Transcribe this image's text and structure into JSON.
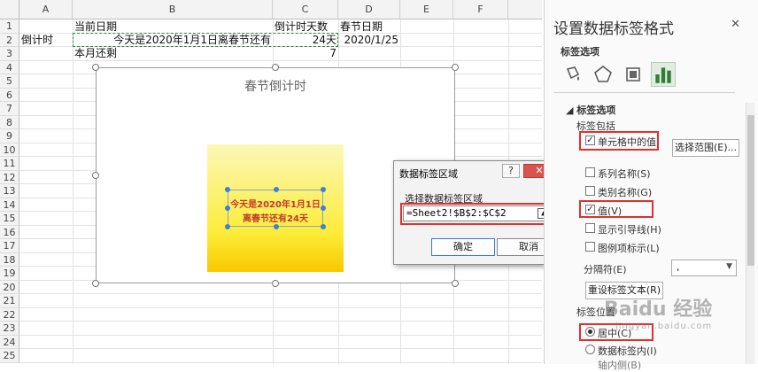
{
  "sheet": {
    "columns": [
      "A",
      "B",
      "C",
      "D",
      "E",
      "F"
    ],
    "rows": [
      "1",
      "2",
      "3",
      "4",
      "5",
      "6",
      "7",
      "8",
      "9",
      "10",
      "11",
      "12",
      "13",
      "14",
      "15",
      "16",
      "17",
      "18",
      "19",
      "20",
      "21",
      "22",
      "23",
      "24",
      "25"
    ],
    "cells": {
      "b1": "当前日期",
      "c1": "倒计时天数",
      "d1": "春节日期",
      "a2": "倒计时",
      "b2": "今天是2020年1月1日离春节还有",
      "c2": "24天",
      "d2": "2020/1/25",
      "b3": "本月还剩",
      "c3": "7"
    }
  },
  "chart": {
    "title": "春节倒计时",
    "label_line1": "今天是2020年1月1日",
    "label_line2": "离春节还有24天",
    "bar_colors": [
      "#fbf8b8",
      "#fdec38",
      "#f7c800"
    ]
  },
  "dialog": {
    "title": "数据标签区域",
    "help": "?",
    "close": "✕",
    "prompt": "选择数据标签区域",
    "range_value": "=Sheet2!$B$2:$C$2",
    "ok": "确定",
    "cancel": "取消"
  },
  "pane": {
    "title": "设置数据标签格式",
    "close": "✕",
    "subtitle": "标签选项",
    "section": "标签选项",
    "contains": "标签包括",
    "options": {
      "value_from_cells": "单元格中的值",
      "select_range": "选择范围(E)...",
      "series_name": "系列名称(S)",
      "category_name": "类别名称(G)",
      "value": "值(V)",
      "leader_lines": "显示引导线(H)",
      "legend_key": "图例项标示(L)"
    },
    "separator_label": "分隔符(E)",
    "separator_value": ",",
    "reset_button": "重设标签文本(R)",
    "position_label": "标签位置",
    "positions": {
      "center": "居中(C)",
      "inside_end": "数据标签内(I)",
      "inside_base": "轴内侧(B)"
    }
  },
  "watermark": {
    "brand": "Baidu 经验",
    "url": "jingyan.baidu.com"
  },
  "accent": "#2e7d32",
  "highlight": "#e03030"
}
